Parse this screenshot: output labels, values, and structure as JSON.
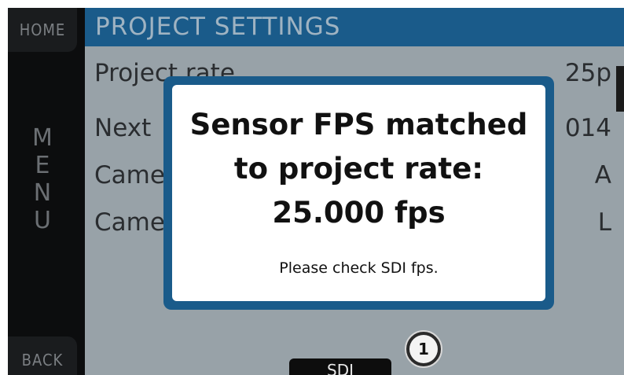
{
  "nav": {
    "home_label": "HOME",
    "menu_letters": [
      "M",
      "E",
      "N",
      "U"
    ],
    "back_label": "BACK"
  },
  "header": {
    "title": "PROJECT SETTINGS"
  },
  "rows": [
    {
      "label": "Project rate",
      "value": "25p"
    },
    {
      "label": "Next",
      "value": "014"
    },
    {
      "label": "Came",
      "value": "A"
    },
    {
      "label": "Came",
      "value": "L"
    }
  ],
  "bottom_tab": {
    "label": "SDI"
  },
  "dialog": {
    "lines": [
      "Sensor FPS matched",
      "to project rate:",
      "25.000 fps"
    ],
    "note": "Please check SDI fps."
  },
  "callout": {
    "number": "1"
  },
  "colors": {
    "header_blue": "#1a5b8a",
    "content_grey": "#98a2a8",
    "rail_dark": "#1a1c1e"
  }
}
